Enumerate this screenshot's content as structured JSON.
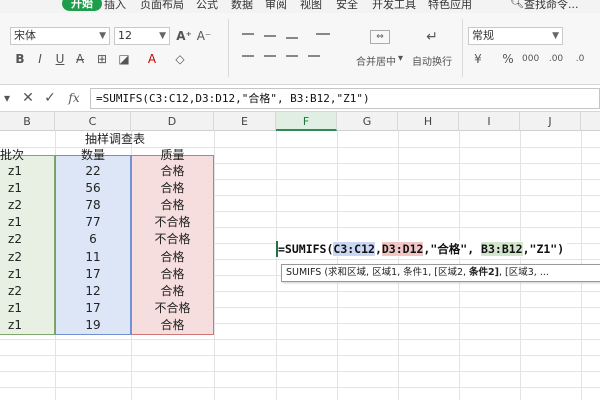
{
  "ribbon_tabs": {
    "start": "开始",
    "insert": "插入",
    "page_layout": "页面布局",
    "formulas": "公式",
    "data": "数据",
    "review": "审阅",
    "view": "视图",
    "security": "安全",
    "developer": "开发工具",
    "features": "特色应用",
    "search": "查找命令..."
  },
  "ribbon": {
    "font_name": "宋体",
    "font_size": "12",
    "number_format": "常规",
    "merge_center": "合并居中",
    "wrap_text": "自动换行"
  },
  "formula_bar": {
    "cell_ref": "",
    "formula": "=SUMIFS(C3:C12,D3:D12,\"合格\", B3:B12,\"Z1\")"
  },
  "columns": [
    "B",
    "C",
    "D",
    "E",
    "F",
    "G",
    "H",
    "I",
    "J"
  ],
  "active_column": "F",
  "table": {
    "title": "抽样调查表",
    "headers": [
      "批次",
      "数量",
      "质量"
    ],
    "rows": [
      [
        "z1",
        "22",
        "合格"
      ],
      [
        "z1",
        "56",
        "合格"
      ],
      [
        "z2",
        "78",
        "合格"
      ],
      [
        "z1",
        "77",
        "不合格"
      ],
      [
        "z2",
        "6",
        "不合格"
      ],
      [
        "z2",
        "11",
        "合格"
      ],
      [
        "z1",
        "17",
        "合格"
      ],
      [
        "z2",
        "12",
        "合格"
      ],
      [
        "z1",
        "17",
        "不合格"
      ],
      [
        "z1",
        "19",
        "合格"
      ]
    ]
  },
  "edit_formula": {
    "prefix": "=SUMIFS(",
    "ref_sum": "C3:C12",
    "sep1": ",",
    "ref_crit1": "D3:D12",
    "crit1": ",\"合格\", ",
    "ref_crit2": "B3:B12",
    "crit2": ",\"Z1\")"
  },
  "tooltip": {
    "text": "SUMIFS (求和区域, 区域1, 条件1, [区域2, ",
    "bold": "条件2]",
    "tail": ", [区域3, ..."
  },
  "colors": {
    "accent_green": "#1e9e4a",
    "sum_range": "#dde6f6",
    "criteria1_range": "#f6dede",
    "criteria2_range": "#e7f0e3"
  }
}
